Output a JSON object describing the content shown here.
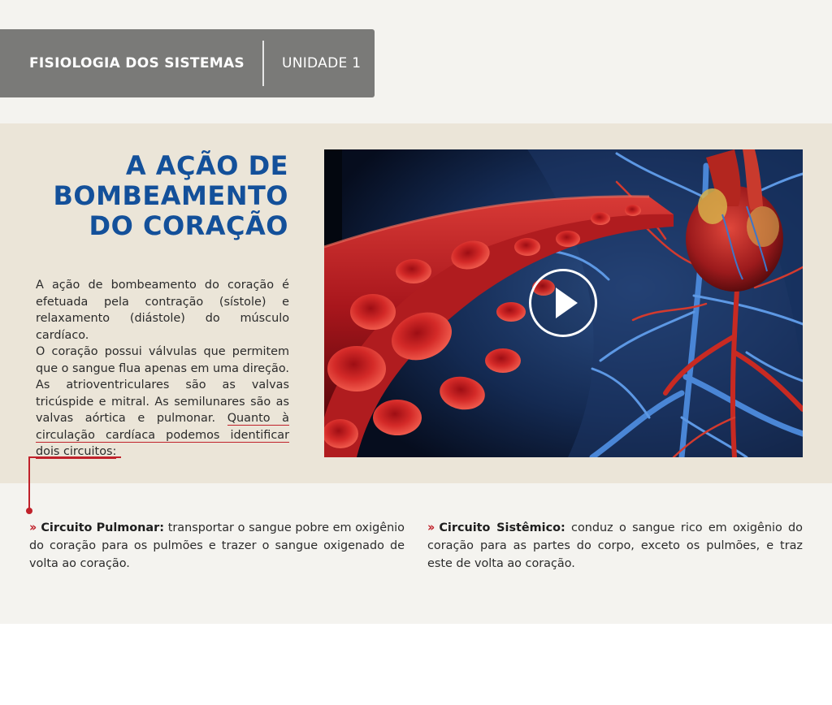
{
  "header": {
    "course": "FISIOLOGIA DOS SISTEMAS",
    "unit": "UNIDADE 1"
  },
  "title": {
    "line1": "A AÇÃO DE",
    "line2": "BOMBEAMENTO",
    "line3": "DO CORAÇÃO"
  },
  "body": {
    "p1": "A ação de bombeamento do coração é efetuada pela contração (sístole) e relaxamento (diástole) do músculo cardíaco.",
    "p2_start": "O coração possui válvulas que permitem que o sangue flua apenas em uma direção. As atrioventriculares são as valvas tricúspide e mitral. As semilunares são as valvas aórtica e pulmonar. ",
    "p2_highlight": "Quanto à circulação cardíaca podemos identificar dois circuitos:"
  },
  "video": {
    "play_icon": "play-icon"
  },
  "circuits": [
    {
      "name": "Circuito Pulmonar:",
      "description": " transportar o sangue pobre em oxigênio do coração para os pulmões e trazer o sangue oxigenado de volta ao coração."
    },
    {
      "name": "Circuito Sistêmico:",
      "description": " conduz o sangue rico em oxigênio do coração para as partes do corpo, exceto os pulmões, e traz este de volta ao coração."
    }
  ],
  "colors": {
    "title_blue": "#13509a",
    "accent_red": "#c0212a",
    "header_gray": "#7a7a78",
    "band_beige": "#ebe5d8",
    "page_bg": "#f4f3ef"
  }
}
